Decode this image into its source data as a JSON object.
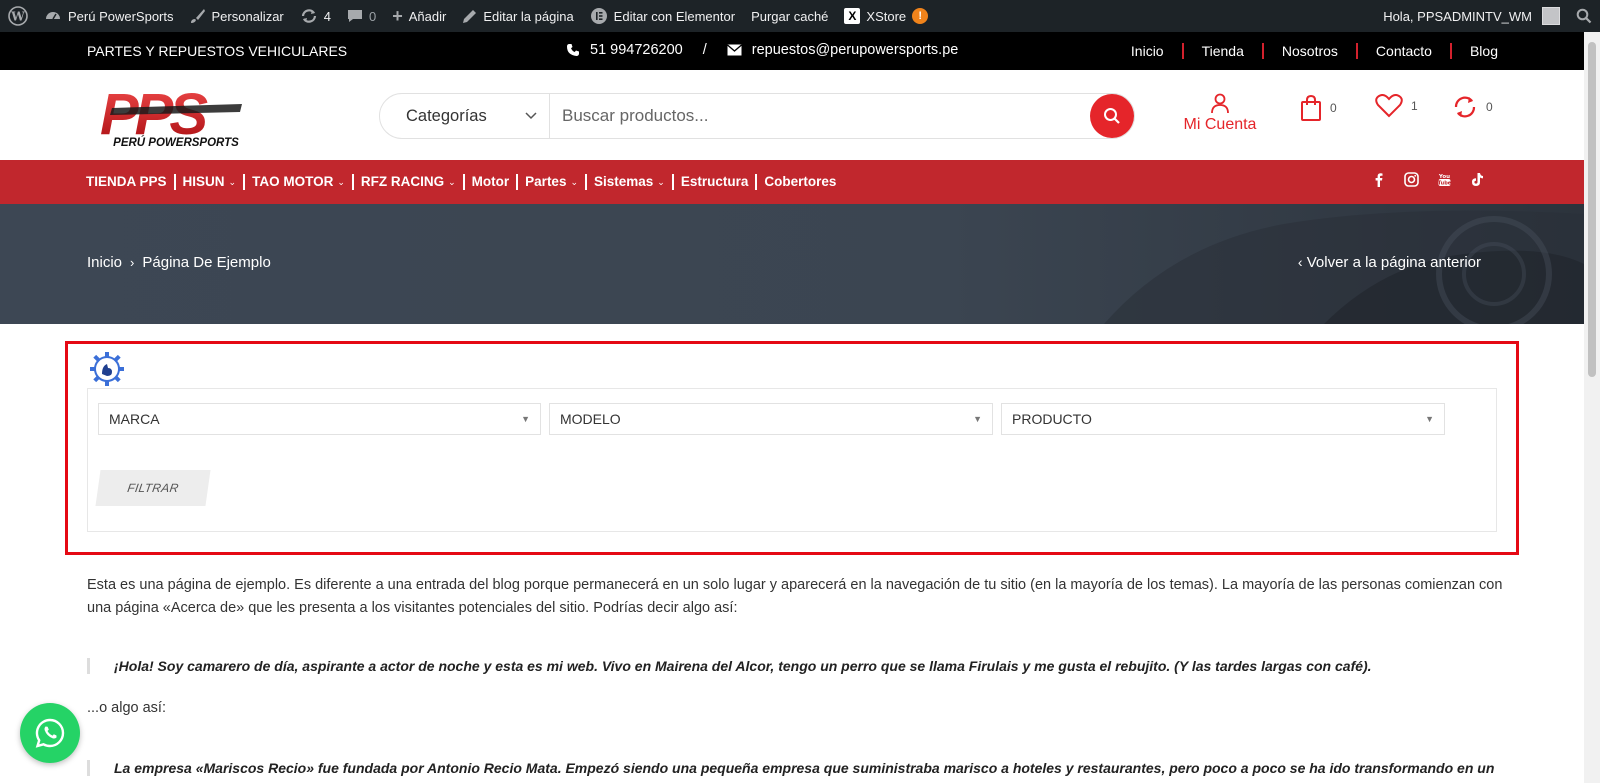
{
  "admin_bar": {
    "site_name": "Perú PowerSports",
    "customize": "Personalizar",
    "updates_count": "4",
    "comments_count": "0",
    "add_new": "Añadir",
    "edit_page": "Editar la página",
    "edit_elementor": "Editar con Elementor",
    "purge_cache": "Purgar caché",
    "xstore": "XStore",
    "xstore_badge": "!",
    "greeting": "Hola, PPSADMINTV_WM"
  },
  "topbar": {
    "tagline": "PARTES Y REPUESTOS VEHICULARES",
    "phone": "51 994726200",
    "divider": "/",
    "email": "repuestos@perupowersports.pe",
    "nav": [
      "Inicio",
      "Tienda",
      "Nosotros",
      "Contacto",
      "Blog"
    ]
  },
  "header": {
    "logo_text": "PPS",
    "logo_subtext": "PERÚ POWERSPORTS",
    "category_label": "Categorías",
    "search_placeholder": "Buscar productos...",
    "account_label": "Mi Cuenta",
    "cart_count": "0",
    "wishlist_count": "1",
    "compare_count": "0"
  },
  "main_nav": {
    "items": [
      {
        "label": "TIENDA PPS",
        "dropdown": false
      },
      {
        "label": "HISUN",
        "dropdown": true
      },
      {
        "label": "TAO MOTOR",
        "dropdown": true
      },
      {
        "label": "RFZ RACING",
        "dropdown": true
      },
      {
        "label": "Motor",
        "dropdown": false
      },
      {
        "label": "Partes",
        "dropdown": true
      },
      {
        "label": "Sistemas",
        "dropdown": true
      },
      {
        "label": "Estructura",
        "dropdown": false
      },
      {
        "label": "Cobertores",
        "dropdown": false
      }
    ],
    "social": [
      "facebook-icon",
      "instagram-icon",
      "youtube-icon",
      "tiktok-icon"
    ]
  },
  "hero": {
    "breadcrumb_home": "Inicio",
    "breadcrumb_current": "Página De Ejemplo",
    "back_link": "Volver a la página anterior"
  },
  "filter": {
    "brand": "MARCA",
    "model": "MODELO",
    "product": "PRODUCTO",
    "button": "FILTRAR"
  },
  "content": {
    "intro": "Esta es una página de ejemplo. Es diferente a una entrada del blog porque permanecerá en un solo lugar y aparecerá en la navegación de tu sitio (en la mayoría de los temas). La mayoría de las personas comienzan con una página «Acerca de» que les presenta a los visitantes potenciales del sitio. Podrías decir algo así:",
    "quote1": "¡Hola! Soy camarero de día, aspirante a actor de noche y esta es mi web. Vivo en Mairena del Alcor, tengo un perro que se llama Firulais y me gusta el rebujito. (Y las tardes largas con café).",
    "or_text": "...o algo así:",
    "quote2": "La empresa «Mariscos Recio» fue fundada por Antonio Recio Mata. Empezó siendo una pequeña empresa que suministraba marisco a hoteles y restaurantes, pero poco a poco se ha ido transformando en un"
  },
  "colors": {
    "accent": "#e5252a",
    "nav_red": "#c1272d",
    "highlight_box": "#e50914",
    "whatsapp": "#25d366"
  }
}
